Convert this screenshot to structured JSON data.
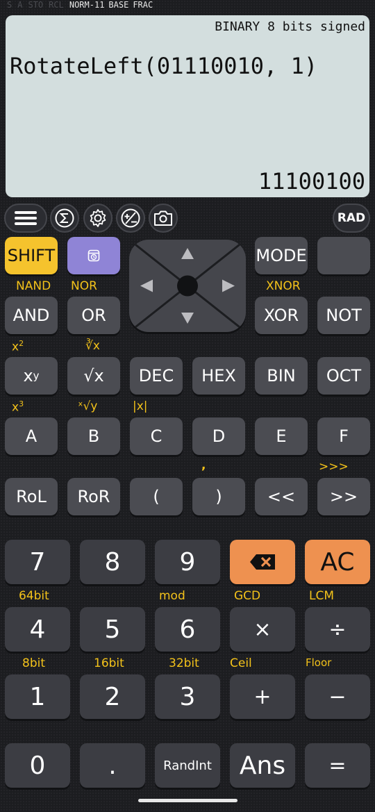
{
  "status": {
    "items_dim": [
      "S",
      "A",
      "STO",
      "RCL"
    ],
    "items_on": [
      "NORM-11",
      "BASE",
      "FRAC"
    ]
  },
  "display": {
    "mode": "BINARY 8 bits signed",
    "expression": "RotateLeft(01110010, 1)",
    "result": "11100100"
  },
  "toolbar": {
    "rad": "RAD",
    "icons": [
      "menu-icon",
      "sigma-icon",
      "gear-icon",
      "plus-minus-icon",
      "camera-icon"
    ]
  },
  "keys": {
    "shift": "SHIFT",
    "mode": "MODE",
    "and": "AND",
    "or": "OR",
    "xor": "XOR",
    "not": "NOT",
    "xy": "x",
    "xy_sup": "y",
    "sqrt": "√x",
    "dec": "DEC",
    "hex": "HEX",
    "bin": "BIN",
    "oct": "OCT",
    "a": "A",
    "b": "B",
    "c": "C",
    "d": "D",
    "e": "E",
    "f": "F",
    "rol": "RoL",
    "ror": "RoR",
    "lparen": "(",
    "rparen": ")",
    "lshift": "<<",
    "rshift": ">>",
    "n7": "7",
    "n8": "8",
    "n9": "9",
    "ac": "AC",
    "n4": "4",
    "n5": "5",
    "n6": "6",
    "mul": "×",
    "div": "÷",
    "n1": "1",
    "n2": "2",
    "n3": "3",
    "plus": "+",
    "minus": "−",
    "n0": "0",
    "dot": ".",
    "randint": "RandInt",
    "ans": "Ans",
    "eq": "="
  },
  "labels": {
    "nand": "NAND",
    "nor": "NOR",
    "xnor": "XNOR",
    "x2": "x",
    "x2_sup": "2",
    "cbrt": "∛x",
    "x3": "x",
    "x3_sup": "3",
    "xrooty": "ˣ√y",
    "abs": "|x|",
    "comma": ",",
    "urshift": ">>>",
    "b64": "64bit",
    "mod": "mod",
    "gcd": "GCD",
    "lcm": "LCM",
    "b8": "8bit",
    "b16": "16bit",
    "b32": "32bit",
    "ceil": "Ceil",
    "floor": "Floor"
  }
}
